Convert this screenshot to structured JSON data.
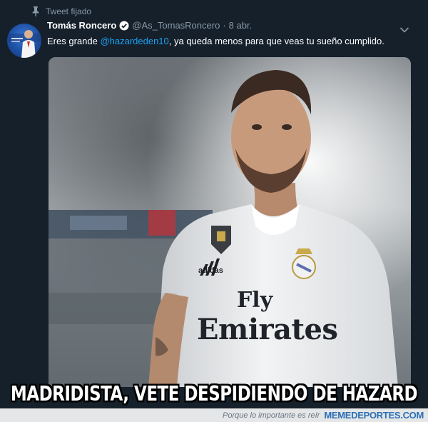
{
  "tweet": {
    "pinned_label": "Tweet fijado",
    "author_name": "Tomás Roncero",
    "handle": "@As_TomasRoncero",
    "separator": "·",
    "date": "8 abr.",
    "text_before": "Eres grande ",
    "mention": "@hazardeden10",
    "text_after": ", ya queda menos para que veas tu sueño cumplido.",
    "icons": {
      "pin": "pin-icon",
      "verified": "verified-badge-icon",
      "more": "chevron-down-icon"
    },
    "colors": {
      "background": "#15202b",
      "muted": "#8899a6",
      "link": "#1da1f2"
    }
  },
  "media": {
    "kit_sponsor_line1": "Fly",
    "kit_sponsor_line2": "Emirates",
    "kit_brand": "adidas"
  },
  "meme": {
    "caption": "MADRIDISTA, VETE DESPIDIENDO DE HAZARD",
    "footer_tagline": "Porque lo importante es reír",
    "footer_brand": "MEMEDEPORTES.COM"
  }
}
